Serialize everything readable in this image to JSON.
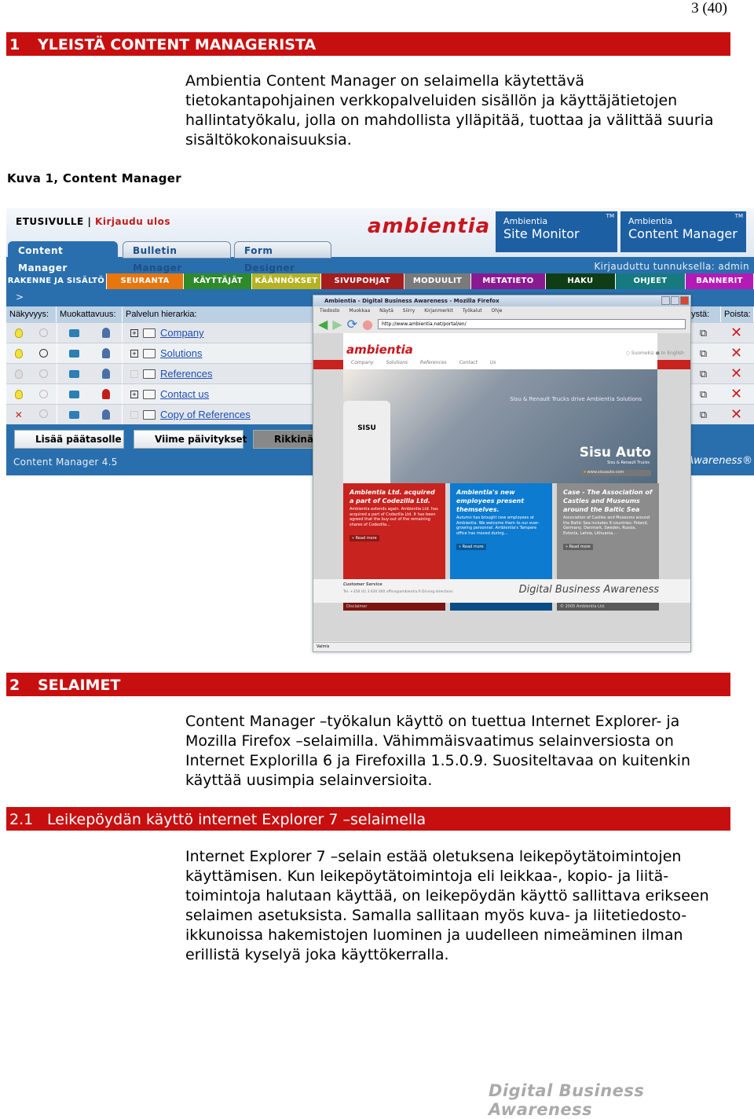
{
  "page_number": "3 (40)",
  "section1": {
    "number": "1",
    "title": "YLEISTÄ CONTENT MANAGERISTA",
    "paragraph": "Ambientia Content Manager on selaimella käytettävä tietokantapohjainen verkkopalveluiden sisällön ja käyttäjätietojen hallintatyökalu, jolla on mahdollista ylläpitää, tuottaa ja välittää suuria sisältökokonaisuuksia."
  },
  "caption": "Kuva 1, Content Manager",
  "screenshot": {
    "etusivulle": "ETUSIVULLE",
    "separator": "|",
    "logout": "Kirjaudu ulos",
    "tabs": [
      "Content Manager",
      "Bulletin Manager",
      "Form Designer"
    ],
    "logo": "ambientia",
    "products": [
      {
        "small": "Ambientia",
        "big": "Site Monitor",
        "tm": "TM"
      },
      {
        "small": "Ambientia",
        "big": "Content Manager",
        "tm": "TM"
      }
    ],
    "logged_in": "Kirjauduttu tunnuksella: admin",
    "menu": [
      {
        "label": "RAKENNE JA SISÄLTÖ",
        "color": "#2a6fad"
      },
      {
        "label": "SEURANTA",
        "color": "#e8760e"
      },
      {
        "label": "KÄYTTÄJÄT",
        "color": "#2f8a2b"
      },
      {
        "label": "KÄÄNNÖKSET",
        "color": "#b6b222"
      },
      {
        "label": "SIVUPOHJAT",
        "color": "#a51d1d"
      },
      {
        "label": "MODUULIT",
        "color": "#7a7a7a"
      },
      {
        "label": "METATIETO",
        "color": "#8a1a8f"
      },
      {
        "label": "HAKU",
        "color": "#0f3d15"
      },
      {
        "label": "OHJEET",
        "color": "#167a7f"
      },
      {
        "label": "BANNERIT",
        "color": "#b41bb6"
      }
    ],
    "crumb": ">",
    "headers": [
      "Näkyvyys:",
      "Muokattavuus:",
      "Palvelun hierarkia:"
    ],
    "right_headers": [
      "ystä:",
      "Poista:"
    ],
    "rows": [
      {
        "name": "Company",
        "visible": true,
        "timed": false,
        "expandable": true,
        "user": "blue"
      },
      {
        "name": "Solutions",
        "visible": true,
        "timed": true,
        "expandable": true,
        "user": "blue"
      },
      {
        "name": "References",
        "visible": false,
        "timed": false,
        "expandable": false,
        "user": "blue"
      },
      {
        "name": "Contact us",
        "visible": true,
        "timed": false,
        "expandable": true,
        "user": "red"
      },
      {
        "name": "Copy of References",
        "visible": "hidden",
        "timed": false,
        "expandable": false,
        "user": "blue"
      }
    ],
    "delete_icon": "✕",
    "buttons": [
      "Lisää päätasolle",
      "Viime päivitykset",
      "Rikkinä"
    ],
    "version": "Content Manager 4.5",
    "awareness": "Awareness®",
    "browser": {
      "title": "Ambientia - Digital Business Awareness - Mozilla Firefox",
      "menu": "Tiedosto Muokkaa Näytä Siirry Kirjanmerkit Työkalut Ohje",
      "url": "http://www.ambientia.net/portal/en/",
      "site_logo": "ambientia",
      "languages": "○ Suomeksi  ● In English",
      "nav": "Company Solutions References Contact Us",
      "hero_tagline": "Sisu & Renault Trucks drive Ambientia Solutions",
      "truck_label": "SISU",
      "hero_title": "Sisu Auto",
      "hero_sub": "Sisu & Renault Trucks",
      "hero_url": "» www.sisuauto.com",
      "news": [
        {
          "title": "Ambientia Ltd. acquired a part of Codezilla Ltd.",
          "body": "Ambientia extends again. Ambientia Ltd. has acquired a part of Codezilla Ltd. It has been agreed that the buy-out of the remaining shares of Codezilla...",
          "more": "» Read more",
          "color": "#c8231f",
          "foot": "Disclaimer",
          "footcolor": "#7a1512"
        },
        {
          "title": "Ambientia's new employees present themselves.",
          "body": "Autumn has brought new employees at Ambientia. We welcome them to our ever-growing personnel. Ambientia's Tampere office has moved during...",
          "more": "» Read more",
          "color": "#0d7bd0",
          "foot": "",
          "footcolor": "#0a4d86"
        },
        {
          "title": "Case - The Association of Castles and Museums around the Baltic Sea",
          "body": "Association of Castles and Museums around the Baltic Sea includes 9 countries: Poland, Germany, Denmark, Sweden, Russia, Estonia, Latvia, Lithuania...",
          "more": "» Read more",
          "color": "#8c8c8c",
          "foot": "© 2005 Ambientia Ltd.",
          "footcolor": "#5a5a5a"
        }
      ],
      "customer_service": "Customer Service",
      "contact": "Tel. +358 (0) 3 630 000   office@ambientia.fi   Driving directions",
      "dba": "Digital Business Awareness",
      "status": "Valmis"
    }
  },
  "section2": {
    "number": "2",
    "title": "SELAIMET",
    "paragraph": "Content Manager –työkalun käyttö on tuettua Internet Explorer- ja Mozilla Firefox –selaimilla. Vähimmäisvaatimus selainversiosta on Internet Explorilla 6 ja Firefoxilla 1.5.0.9. Suositeltavaa on kuitenkin käyttää uusimpia selainversioita."
  },
  "section21": {
    "number": "2.1",
    "title": "Leikepöydän käyttö internet Explorer 7 –selaimella",
    "paragraph": "Internet Explorer 7 –selain estää oletuksena leikepöytätoimintojen käyttämisen. Kun leikepöytätoimintoja eli leikkaa-, kopio- ja liitä-toimintoja halutaan käyttää, on leikepöydän käyttö sallittava erikseen selaimen asetuksista. Samalla sallitaan myös kuva- ja liitetiedosto-ikkunoissa hakemistojen luominen ja uudelleen nimeäminen ilman erillistä kyselyä joka käyttökerralla."
  },
  "footer": "Digital Business Awareness"
}
